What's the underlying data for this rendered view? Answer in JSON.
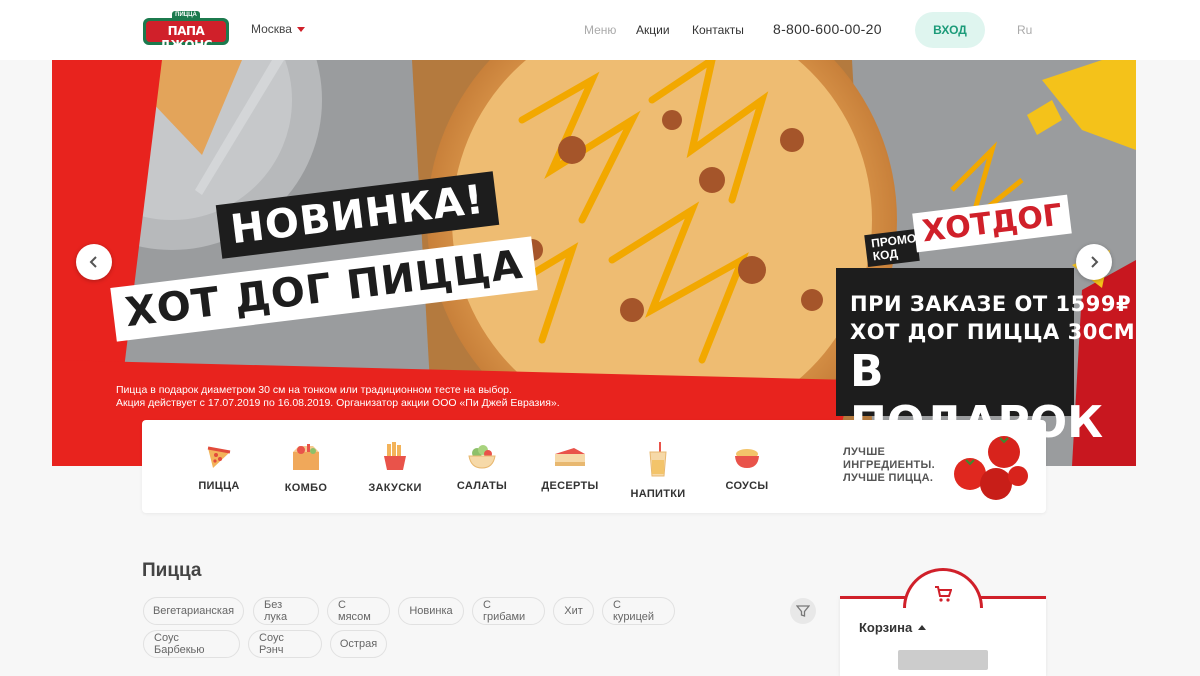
{
  "header": {
    "logo_text": "ПАПА ДЖОНС",
    "logo_sub": "ПИЦЦА",
    "city": "Москва",
    "nav": {
      "menu": "Меню",
      "promo": "Акции",
      "contacts": "Контакты"
    },
    "phone": "8-800-600-00-20",
    "login_label": "ВХОД",
    "lang": "Ru"
  },
  "banner": {
    "headline_1": "НОВИНКА!",
    "headline_2": "ХОТ ДОГ ПИЦЦА",
    "disclaimer_1": "Пицца в подарок диаметром 30 см на тонком или традиционном тесте на выбор.",
    "disclaimer_2": "Акция действует с 17.07.2019 по 16.08.2019. Организатор акции ООО «Пи Джей Евразия».",
    "promo_label": "ПРОМО КОД",
    "promo_code": "ХОТДОГ",
    "offer_1": "ПРИ ЗАКАЗЕ ОТ 1599₽",
    "offer_2": "ХОТ ДОГ ПИЦЦА 30СМ",
    "offer_3": "В ПОДАРОК",
    "prev_icon": "chevron-left-icon",
    "next_icon": "chevron-right-icon"
  },
  "categories": [
    {
      "label": "ПИЦЦА",
      "icon": "pizza-icon"
    },
    {
      "label": "КОМБО",
      "icon": "combo-box-icon"
    },
    {
      "label": "ЗАКУСКИ",
      "icon": "snacks-icon"
    },
    {
      "label": "САЛАТЫ",
      "icon": "salad-icon"
    },
    {
      "label": "ДЕСЕРТЫ",
      "icon": "cake-icon"
    },
    {
      "label": "НАПИТКИ",
      "icon": "drink-icon"
    },
    {
      "label": "СОУСЫ",
      "icon": "sauce-icon"
    }
  ],
  "tagline": {
    "line1": "ЛУЧШЕ",
    "line2": "ИНГРЕДИЕНТЫ.",
    "line3": "ЛУЧШЕ ПИЦЦА."
  },
  "section": {
    "title": "Пицца"
  },
  "filters": [
    "Вегетарианская",
    "Без лука",
    "С мясом",
    "Новинка",
    "С грибами",
    "Хит",
    "С курицей",
    "Соус Барбекью",
    "Соус Рэнч",
    "Острая"
  ],
  "cart": {
    "title": "Корзина",
    "icon": "cart-icon"
  },
  "colors": {
    "brand_red": "#d0202a",
    "brand_green": "#1c9b79",
    "login_bg": "#dff5ef",
    "bg": "#f7f7f7"
  }
}
